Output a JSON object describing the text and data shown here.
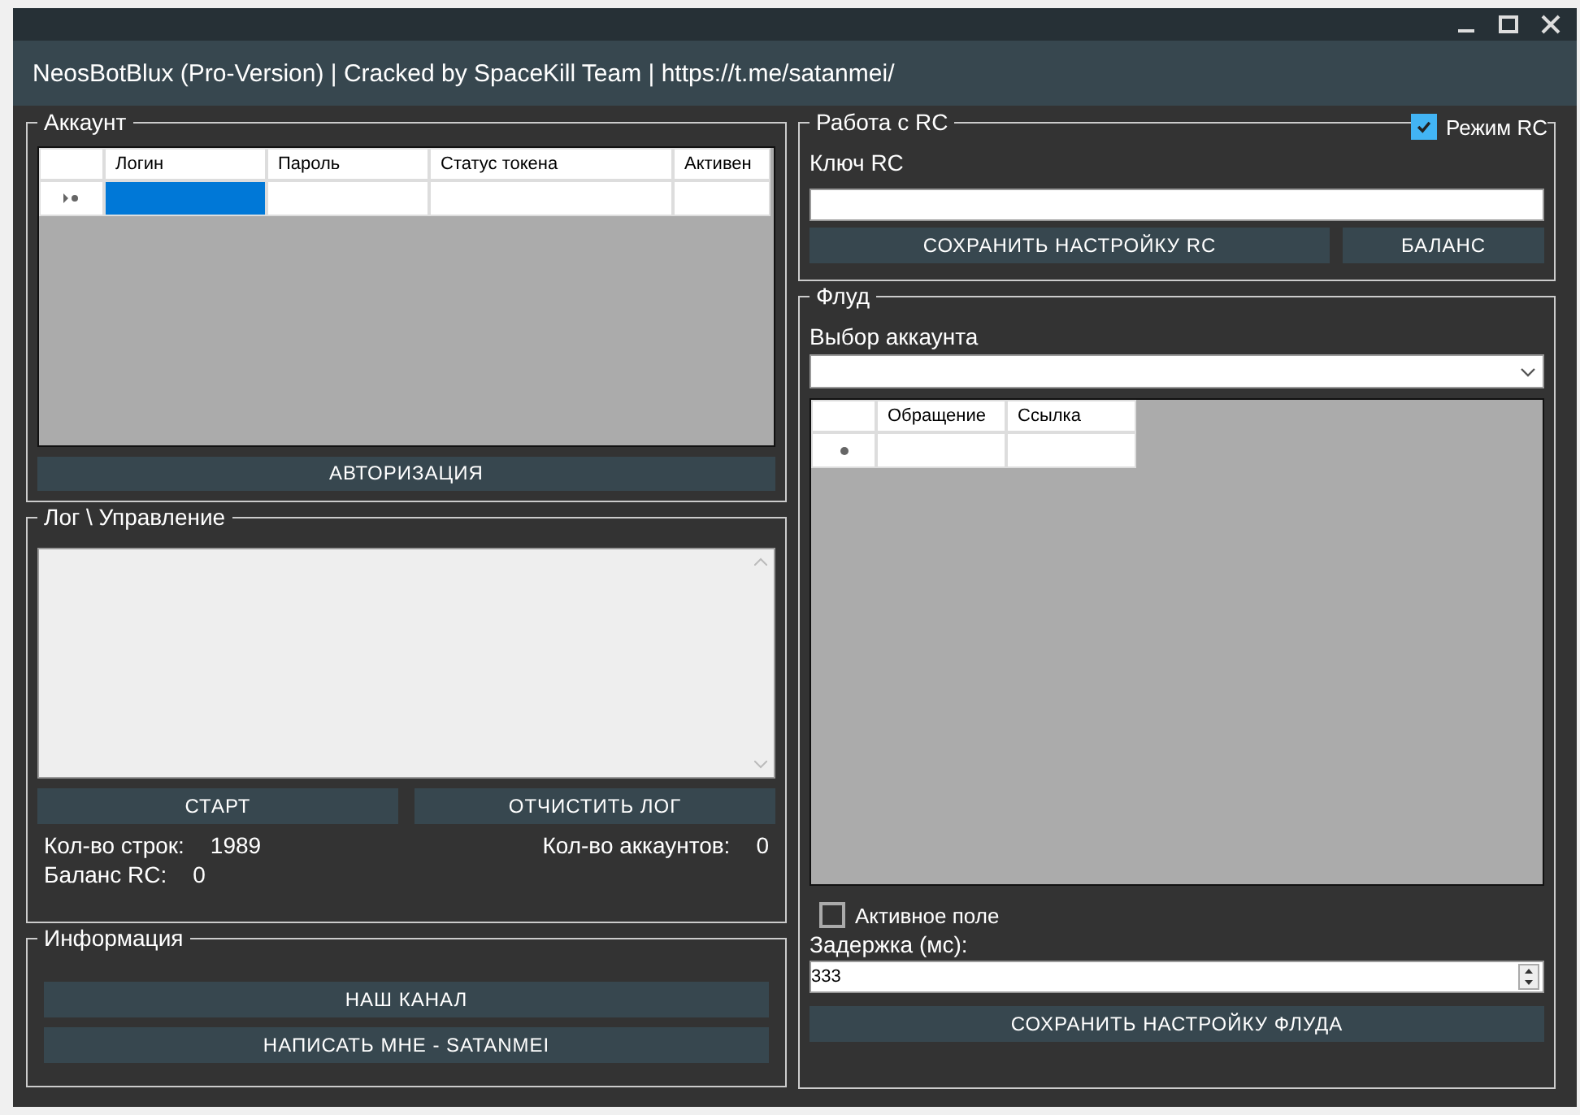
{
  "window": {
    "title": "NeosBotBlux (Pro-Version) | Cracked by SpaceKill Team | https://t.me/satanmei/"
  },
  "account": {
    "title": "Аккаунт",
    "columns": [
      "Логин",
      "Пароль",
      "Статус токена",
      "Активен"
    ],
    "rows": [
      {
        "cells": [
          {
            "selected": true
          },
          {
            "selected": false
          },
          {
            "selected": false
          },
          {
            "selected": false
          }
        ]
      }
    ],
    "button": "АВТОРИЗАЦИЯ"
  },
  "log": {
    "title": "Лог \\ Управление",
    "buttons": [
      "СТАРТ",
      "ОТЧИСТИТЬ ЛОГ"
    ],
    "stats": [
      {
        "label": "Кол-во строк:",
        "value": "1989"
      },
      {
        "label": "Кол-во аккаунтов:",
        "value": "0"
      },
      {
        "label": "Баланс RC:",
        "value": "0"
      }
    ]
  },
  "info": {
    "title": "Информация",
    "buttons": [
      "НАШ КАНАЛ",
      "НАПИСАТЬ МНЕ - SATANMEI"
    ]
  },
  "rc": {
    "title": "Работа с RC",
    "mode_label": "Режим RC",
    "mode_checked": true,
    "key_label": "Ключ RC",
    "buttons": [
      "СОХРАНИТЬ НАСТРОЙКУ RC",
      "БАЛАНС"
    ]
  },
  "flood": {
    "title": "Флуд",
    "account_label": "Выбор аккаунта",
    "columns": [
      "Обращение",
      "Ссылка"
    ],
    "active_label": "Активное поле",
    "active_checked": false,
    "delay_label": "Задержка (мс):",
    "delay_value": "333",
    "button": "СОХРАНИТЬ НАСТРОЙКУ ФЛУДА"
  }
}
